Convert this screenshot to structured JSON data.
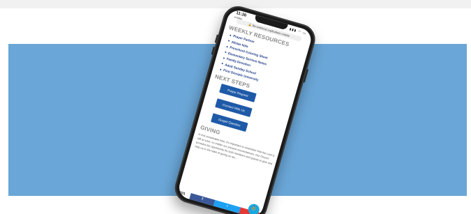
{
  "phone": {
    "status": {
      "time": "11:36",
      "app_back": "◂ Safari",
      "icons": "▮▮▮ ◠ ▭"
    },
    "url": "🔒 fbc-webhost.org/bulletin-mobile",
    "sections": {
      "weekly_heading": "WEEKLY RESOURCES",
      "resources": [
        "Prayer Partner",
        "Allstar kids",
        "Preschool Coloring Sheet",
        "Elementary Sermon Notes",
        "Family Devotion",
        "Adult Sunday School",
        "First Disciple University"
      ],
      "next_heading": "NEXT STEPS",
      "buttons": [
        "Prayer Request",
        "Connect With Us",
        "Gospel Question"
      ],
      "giving_heading": "GIVING",
      "giving_text": "In this remarkable time, it's important to remember that the Lord is still at work, no matter our present circumstances. Our Church provides the opportunity for both members and guests to give and help us in the habit of giving as we..."
    },
    "bottom_bar": {
      "number": "101",
      "facebook_icon": "f",
      "twitter_icon": "t",
      "fab_icon": "person-walk-icon",
      "fab_glyph": "⛹"
    }
  },
  "colors": {
    "blue_panel": "#6aa6d7",
    "link_blue": "#1e3a8a",
    "button_blue": "#1e5aa8",
    "fab": "#18a8e0"
  }
}
